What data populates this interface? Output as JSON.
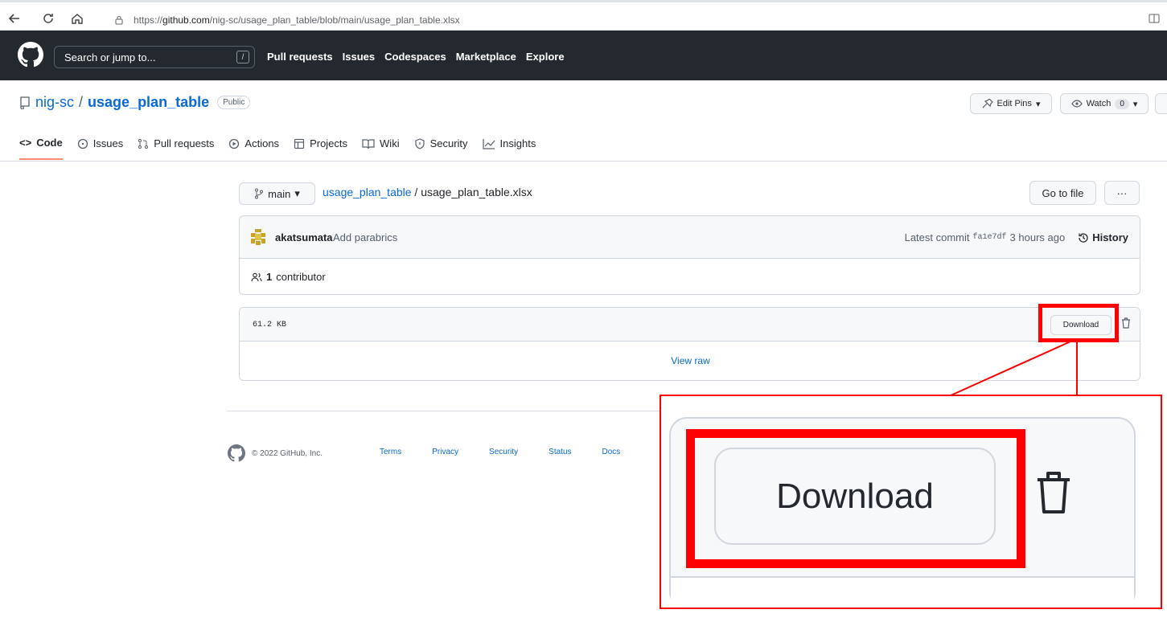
{
  "browser": {
    "url_prefix": "https://",
    "url_host": "github.com",
    "url_path": "/nig-sc/usage_plan_table/blob/main/usage_plan_table.xlsx"
  },
  "header": {
    "search_placeholder": "Search or jump to...",
    "slash_key": "/",
    "links": [
      "Pull requests",
      "Issues",
      "Codespaces",
      "Marketplace",
      "Explore"
    ]
  },
  "repo": {
    "owner": "nig-sc",
    "separator": "/",
    "name": "usage_plan_table",
    "visibility": "Public",
    "edit_pins_label": "Edit Pins",
    "watch_label": "Watch",
    "watch_count": "0"
  },
  "tabs": [
    {
      "label": "Code",
      "icon": "code-icon"
    },
    {
      "label": "Issues",
      "icon": "issue-icon"
    },
    {
      "label": "Pull requests",
      "icon": "pull-request-icon"
    },
    {
      "label": "Actions",
      "icon": "play-icon"
    },
    {
      "label": "Projects",
      "icon": "table-icon"
    },
    {
      "label": "Wiki",
      "icon": "book-icon"
    },
    {
      "label": "Security",
      "icon": "shield-icon"
    },
    {
      "label": "Insights",
      "icon": "graph-icon"
    }
  ],
  "file": {
    "branch": "main",
    "path_repo": "usage_plan_table",
    "path_sep": " / ",
    "filename": "usage_plan_table.xlsx",
    "goto_label": "Go to file",
    "more_label": "···"
  },
  "commit": {
    "author": "akatsumata",
    "message": "Add parabrics",
    "latest_label": "Latest commit",
    "sha": "fa1e7df",
    "time": "3 hours ago",
    "history_label": "History",
    "contributors_count": "1",
    "contributors_label": "contributor"
  },
  "blob": {
    "size": "61.2 KB",
    "download_label": "Download",
    "view_raw_label": "View raw"
  },
  "footer": {
    "copyright": "© 2022 GitHub, Inc.",
    "links": [
      "Terms",
      "Privacy",
      "Security",
      "Status",
      "Docs"
    ]
  },
  "zoom": {
    "download_label": "Download"
  },
  "colors": {
    "header_bg": "#24292f",
    "link_blue": "#0969da",
    "highlight_red": "#ff0000",
    "tab_underline": "#fd8c73"
  }
}
